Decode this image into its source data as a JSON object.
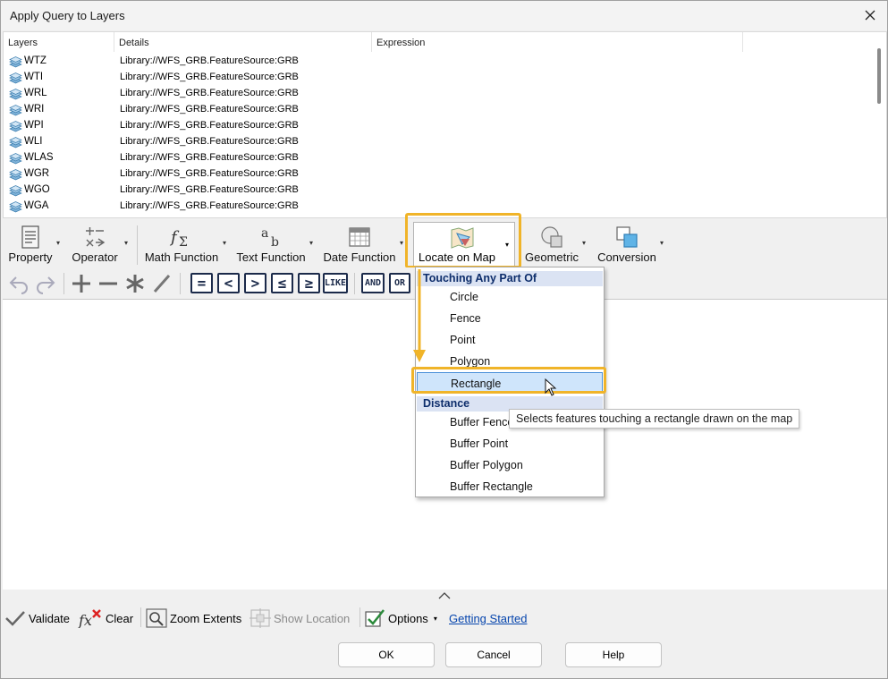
{
  "window": {
    "title": "Apply Query to Layers"
  },
  "layers": {
    "columns": [
      "Layers",
      "Details",
      "Expression"
    ],
    "rows": [
      {
        "name": "WTZ",
        "details": "Library://WFS_GRB.FeatureSource:GRB"
      },
      {
        "name": "WTI",
        "details": "Library://WFS_GRB.FeatureSource:GRB"
      },
      {
        "name": "WRL",
        "details": "Library://WFS_GRB.FeatureSource:GRB"
      },
      {
        "name": "WRI",
        "details": "Library://WFS_GRB.FeatureSource:GRB"
      },
      {
        "name": "WPI",
        "details": "Library://WFS_GRB.FeatureSource:GRB"
      },
      {
        "name": "WLI",
        "details": "Library://WFS_GRB.FeatureSource:GRB"
      },
      {
        "name": "WLAS",
        "details": "Library://WFS_GRB.FeatureSource:GRB"
      },
      {
        "name": "WGR",
        "details": "Library://WFS_GRB.FeatureSource:GRB"
      },
      {
        "name": "WGO",
        "details": "Library://WFS_GRB.FeatureSource:GRB"
      },
      {
        "name": "WGA",
        "details": "Library://WFS_GRB.FeatureSource:GRB"
      }
    ]
  },
  "toolbar": {
    "property": "Property",
    "operator": "Operator",
    "math_function": "Math Function",
    "text_function": "Text Function",
    "date_function": "Date Function",
    "locate_on_map": "Locate on Map",
    "geometric": "Geometric",
    "conversion": "Conversion"
  },
  "operators": {
    "like": "LIKE",
    "and": "AND",
    "or": "OR"
  },
  "dropdown": {
    "header1": "Touching Any Part Of",
    "items1": [
      "Circle",
      "Fence",
      "Point",
      "Polygon",
      "Rectangle"
    ],
    "header2": "Distance",
    "items2": [
      "Buffer Fence",
      "Buffer Point",
      "Buffer Polygon",
      "Buffer Rectangle"
    ],
    "selected": "Rectangle",
    "tooltip": "Selects features touching a rectangle drawn on the map"
  },
  "bottombar": {
    "validate": "Validate",
    "clear": "Clear",
    "zoom_extents": "Zoom Extents",
    "show_location": "Show Location",
    "options": "Options",
    "getting_started": "Getting Started"
  },
  "buttons": {
    "ok": "OK",
    "cancel": "Cancel",
    "help": "Help"
  },
  "colors": {
    "highlight": "#f0b429",
    "selection": "#cfe5fb",
    "header_text": "#0d2d6b",
    "link": "#0645ad"
  }
}
